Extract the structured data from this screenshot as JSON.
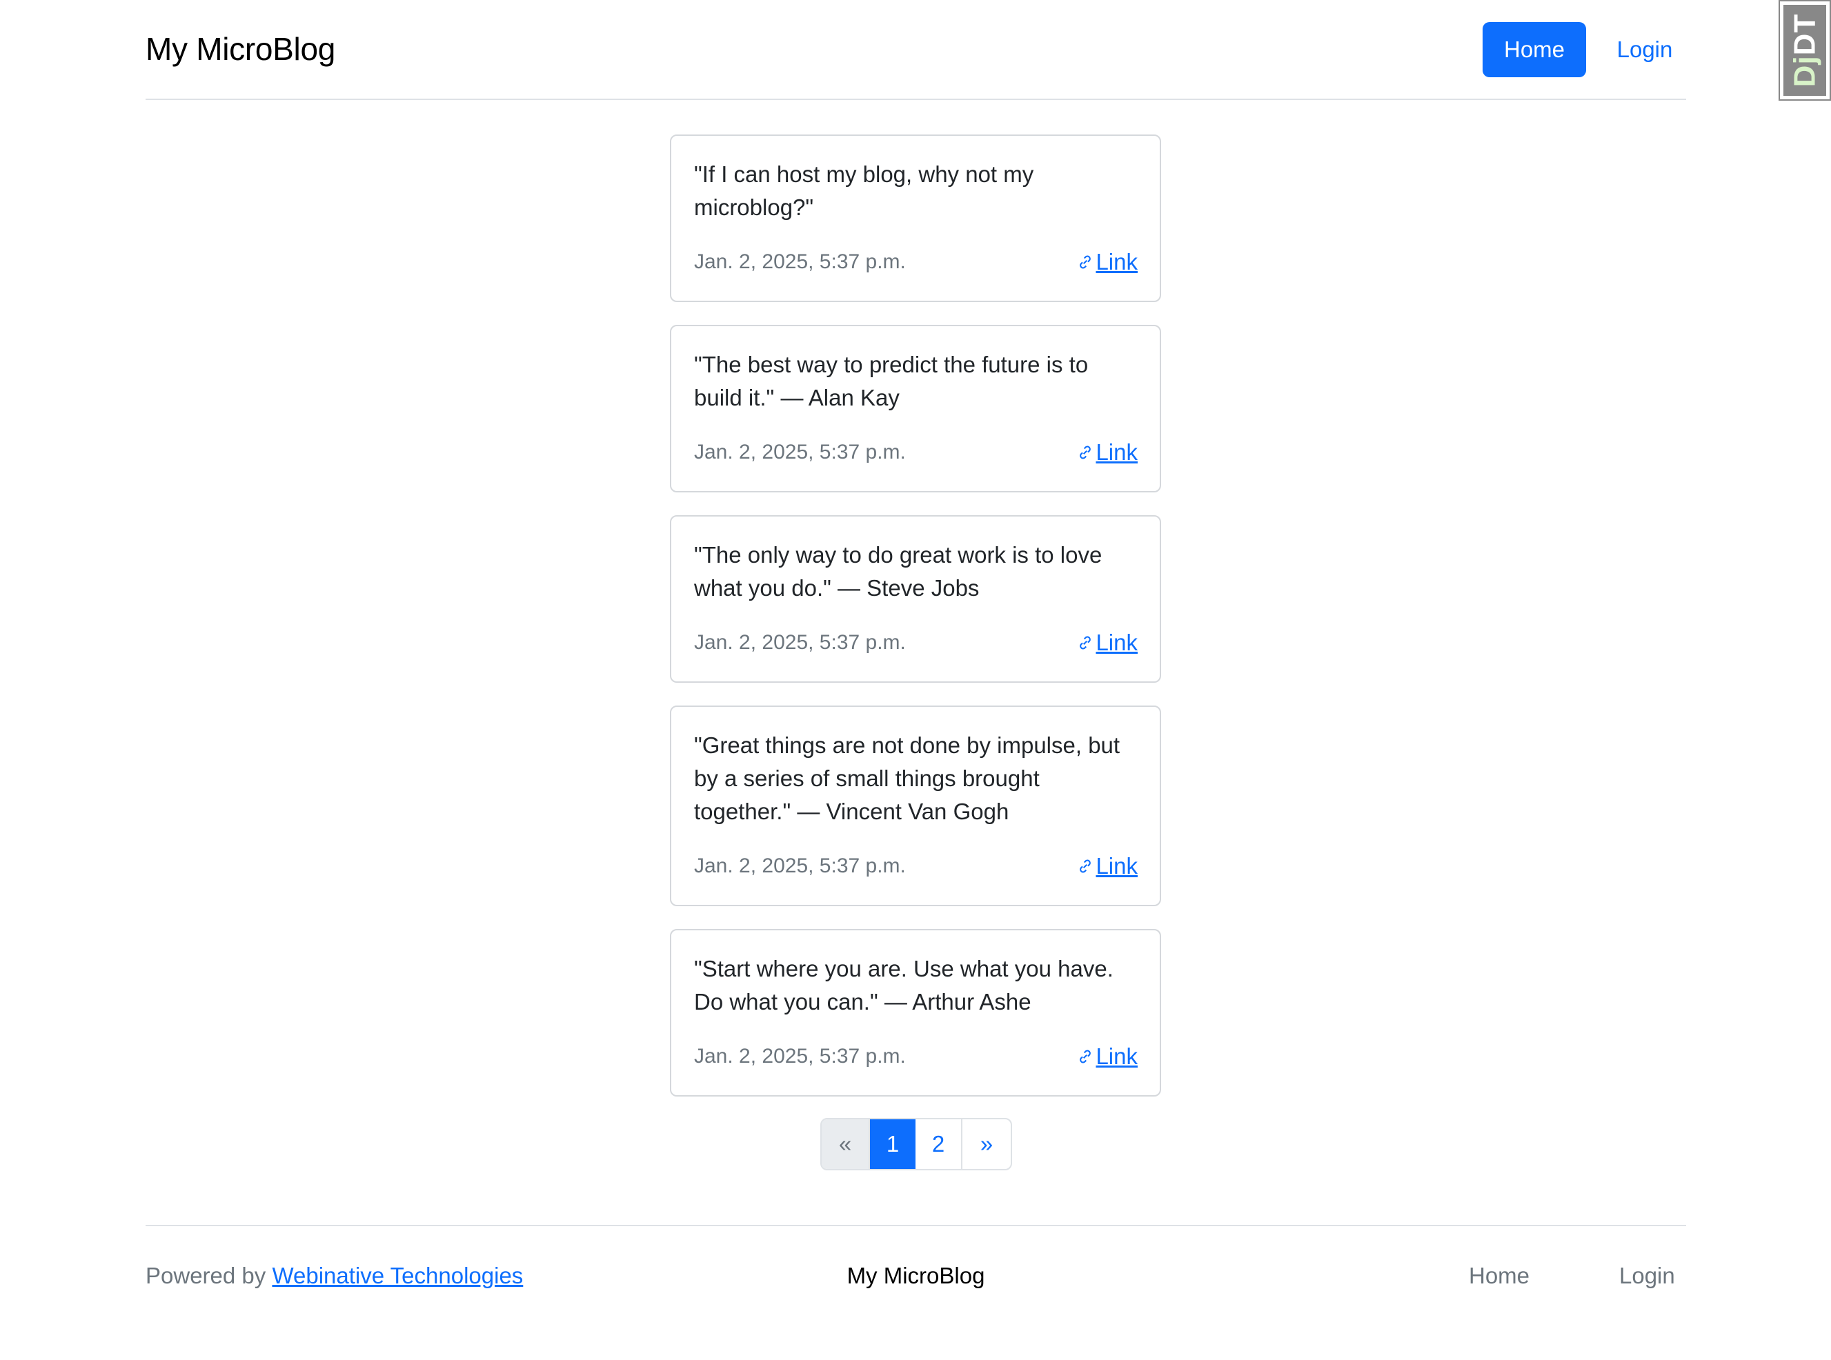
{
  "header": {
    "brand": "My MicroBlog",
    "nav": {
      "home": "Home",
      "login": "Login"
    }
  },
  "debug_toolbar": {
    "dj": "Dj",
    "dt": "DT"
  },
  "posts": [
    {
      "text": "\"If I can host my blog, why not my microblog?\"",
      "date": "Jan. 2, 2025, 5:37 p.m.",
      "link_label": "Link"
    },
    {
      "text": "\"The best way to predict the future is to build it.\" — Alan Kay",
      "date": "Jan. 2, 2025, 5:37 p.m.",
      "link_label": "Link"
    },
    {
      "text": "\"The only way to do great work is to love what you do.\" — Steve Jobs",
      "date": "Jan. 2, 2025, 5:37 p.m.",
      "link_label": "Link"
    },
    {
      "text": "\"Great things are not done by impulse, but by a series of small things brought together.\" — Vincent Van Gogh",
      "date": "Jan. 2, 2025, 5:37 p.m.",
      "link_label": "Link"
    },
    {
      "text": "\"Start where you are. Use what you have. Do what you can.\" — Arthur Ashe",
      "date": "Jan. 2, 2025, 5:37 p.m.",
      "link_label": "Link"
    }
  ],
  "pagination": {
    "prev": "«",
    "pages": [
      "1",
      "2"
    ],
    "current": "1",
    "next": "»"
  },
  "footer": {
    "powered_prefix": "Powered by",
    "powered_link": "Webinative Technologies",
    "brand": "My MicroBlog",
    "nav": {
      "home": "Home",
      "login": "Login"
    }
  },
  "colors": {
    "accent": "#0d6efd",
    "muted": "#6c757d",
    "border": "#dee2e6"
  }
}
